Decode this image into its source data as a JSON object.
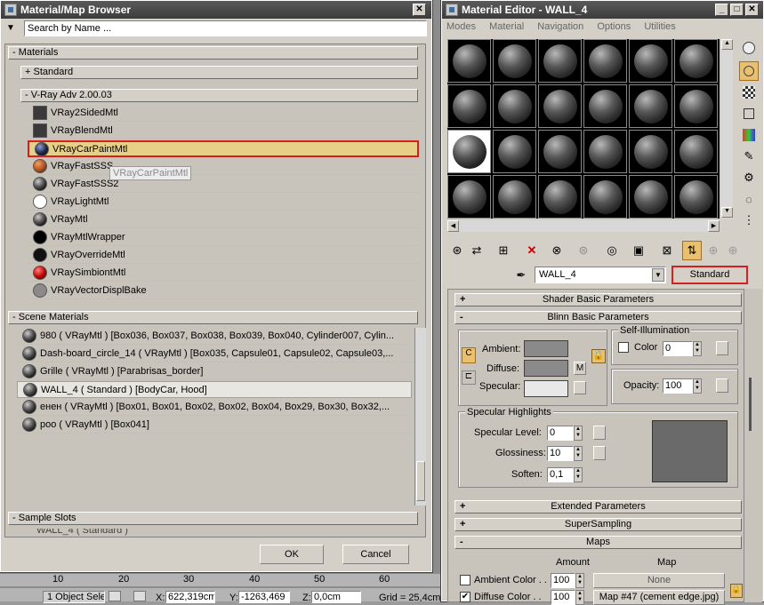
{
  "browser": {
    "title": "Material/Map Browser",
    "search_placeholder": "Search by Name ...",
    "sections": {
      "materials": "- Materials",
      "standard": "+ Standard",
      "vray": "- V-Ray Adv 2.00.03",
      "scene": "- Scene Materials",
      "sample": "- Sample Slots"
    },
    "vray_items": [
      {
        "label": "VRay2SidedMtl",
        "swatch": "#3a3a3a"
      },
      {
        "label": "VRayBlendMtl",
        "swatch": "#3a3a3a"
      },
      {
        "label": "VRayCarPaintMtl",
        "swatch": "#1d2444"
      },
      {
        "label": "VRayFastSSS",
        "swatch": "#b05020"
      },
      {
        "label": "VRayFastSSS2",
        "swatch": "#555"
      },
      {
        "label": "VRayLightMtl",
        "swatch": "#ffffff"
      },
      {
        "label": "VRayMtl",
        "swatch": "#555"
      },
      {
        "label": "VRayMtlWrapper",
        "swatch": "#000"
      },
      {
        "label": "VRayOverrideMtl",
        "swatch": "#111"
      },
      {
        "label": "VRaySimbiontMtl",
        "swatch": "#c00000"
      },
      {
        "label": "VRayVectorDisplBake",
        "swatch": "#888"
      }
    ],
    "tooltip": "VRayCarPaintMtl",
    "scene_items": [
      "980  ( VRayMtl ) [Box036, Box037, Box038, Box039, Box040, Cylinder007, Cylin...",
      "Dash-board_circle_14  ( VRayMtl ) [Box035, Capsule01, Capsule02, Capsule03,...",
      "Grille  ( VRayMtl ) [Parabrisas_border]",
      "WALL_4  ( Standard ) [BodyCar, Hood]",
      "енен  ( VRayMtl ) [Box01, Box01, Box02, Box02, Box04, Box29, Box30, Box32,...",
      "poo  ( VRayMtl ) [Box041]"
    ],
    "sample_partial": "WALL_4  ( Standard )",
    "ok": "OK",
    "cancel": "Cancel"
  },
  "editor": {
    "title": "Material Editor - WALL_4",
    "menu": [
      "Modes",
      "Material",
      "Navigation",
      "Options",
      "Utilities"
    ],
    "material_name": "WALL_4",
    "material_type": "Standard",
    "rollouts": {
      "shader": "Shader Basic Parameters",
      "blinn": "Blinn Basic Parameters",
      "extended": "Extended Parameters",
      "supersampling": "SuperSampling",
      "maps": "Maps"
    },
    "blinn": {
      "ambient": "Ambient:",
      "diffuse": "Diffuse:",
      "specular": "Specular:",
      "self_illum": "Self-Illumination",
      "color_label": "Color",
      "color_value": "0",
      "opacity_label": "Opacity:",
      "opacity_value": "100",
      "m_button": "M",
      "spec_highlights": "Specular Highlights",
      "spec_level_label": "Specular Level:",
      "spec_level": "0",
      "gloss_label": "Glossiness:",
      "gloss": "10",
      "soften_label": "Soften:",
      "soften": "0,1"
    },
    "maps": {
      "amount_header": "Amount",
      "map_header": "Map",
      "rows": [
        {
          "label": "Ambient Color . .",
          "amount": "100",
          "map": "None",
          "checked": false
        },
        {
          "label": "Diffuse Color . .",
          "amount": "100",
          "map": "Map #47 (cement edge.jpg)",
          "checked": true
        }
      ]
    },
    "colors": {
      "ambient": "#8a8a8a",
      "diffuse": "#8a8a8a",
      "specular": "#e8e8e8",
      "preview": "#6a6a6a"
    }
  },
  "statusbar": {
    "ruler": [
      "10",
      "20",
      "30",
      "40",
      "50",
      "60"
    ],
    "selection": "1 Object Sele",
    "x_label": "X:",
    "x_value": "622,319cm",
    "y_label": "Y:",
    "y_value": "-1263,469",
    "z_label": "Z:",
    "z_value": "0,0cm",
    "grid": "Grid = 25,4cm"
  }
}
